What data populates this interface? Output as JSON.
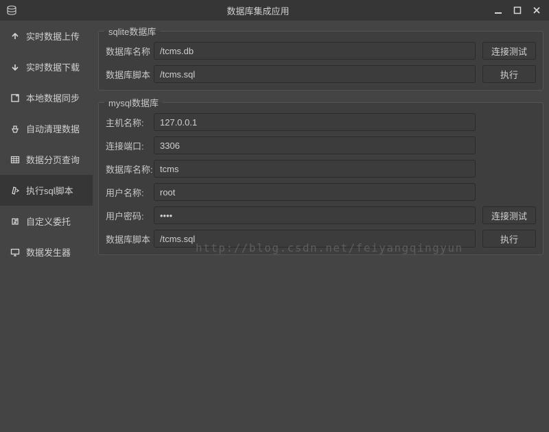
{
  "window": {
    "title": "数据库集成应用"
  },
  "sidebar": {
    "items": [
      {
        "label": "实时数据上传"
      },
      {
        "label": "实时数据下载"
      },
      {
        "label": "本地数据同步"
      },
      {
        "label": "自动清理数据"
      },
      {
        "label": "数据分页查询"
      },
      {
        "label": "执行sql脚本"
      },
      {
        "label": "自定义委托"
      },
      {
        "label": "数据发生器"
      }
    ],
    "active_index": 5
  },
  "sqlite": {
    "legend": "sqlite数据库",
    "db_name_label": "数据库名称",
    "db_name_value": "/tcms.db",
    "db_script_label": "数据库脚本",
    "db_script_value": "/tcms.sql",
    "test_button": "连接测试",
    "exec_button": "执行"
  },
  "mysql": {
    "legend": "mysql数据库",
    "host_label": "主机名称:",
    "host_value": "127.0.0.1",
    "port_label": "连接端口:",
    "port_value": "3306",
    "db_name_label": "数据库名称:",
    "db_name_value": "tcms",
    "user_label": "用户名称:",
    "user_value": "root",
    "pass_label": "用户密码:",
    "pass_value": "••••",
    "db_script_label": "数据库脚本",
    "db_script_value": "/tcms.sql",
    "test_button": "连接测试",
    "exec_button": "执行"
  },
  "watermark": "http://blog.csdn.net/feiyangqingyun"
}
